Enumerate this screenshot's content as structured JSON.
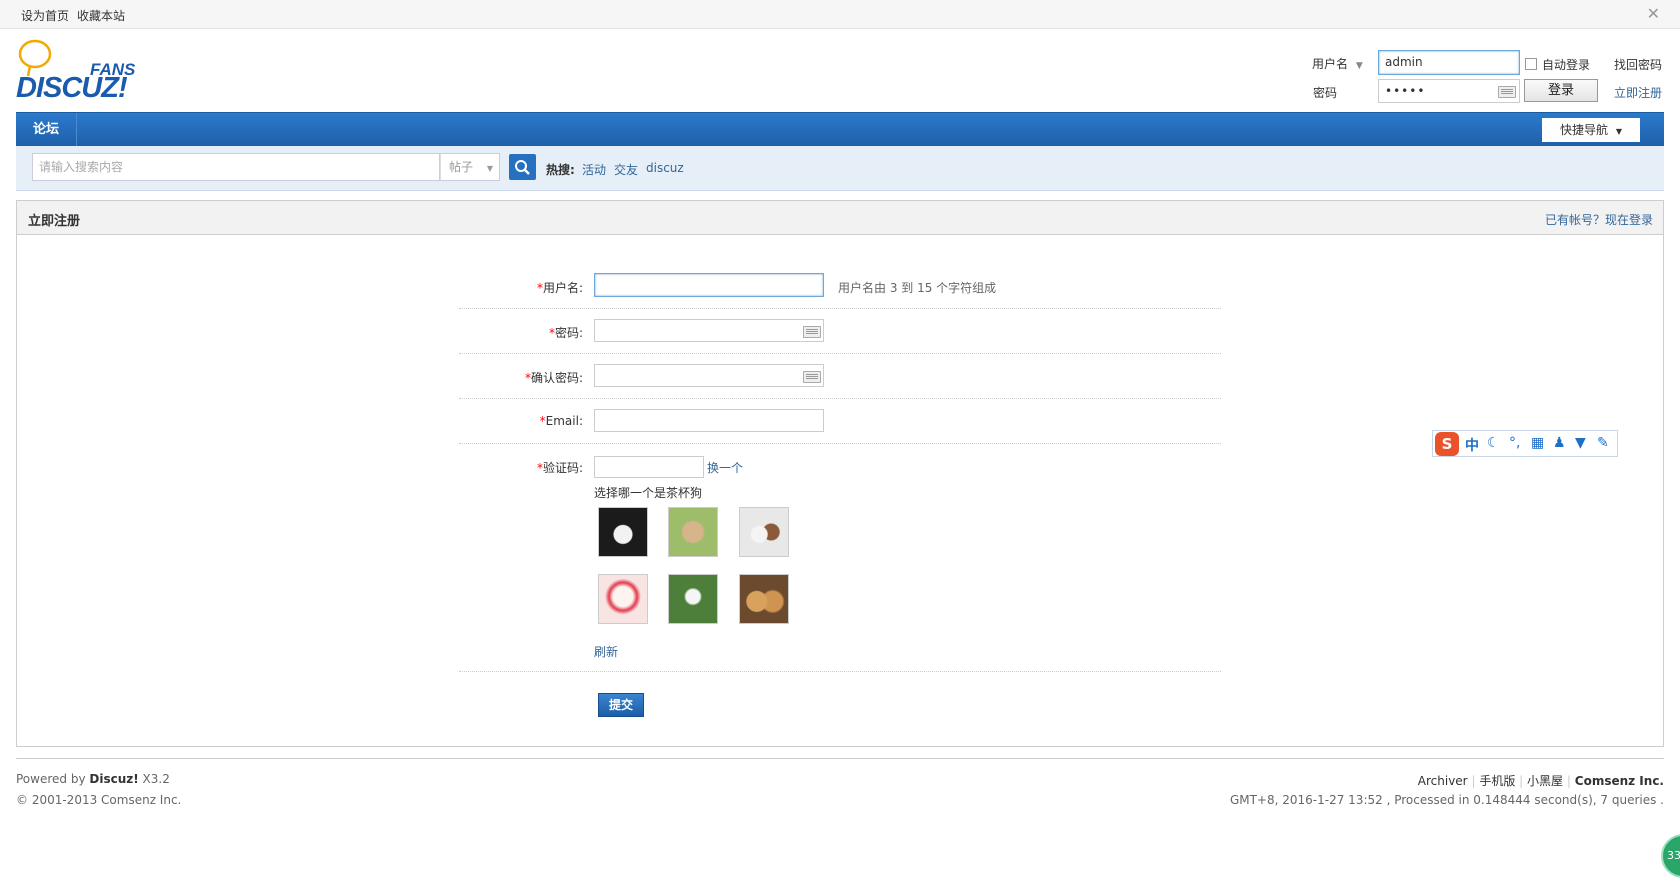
{
  "topbar": {
    "set_home": "设为首页",
    "bookmark": "收藏本站"
  },
  "logo": {
    "fans": "FANS",
    "discuz": "DISCUZ!"
  },
  "login": {
    "username_label": "用户名",
    "username_value": "admin",
    "auto_login": "自动登录",
    "find_password": "找回密码",
    "password_label": "密码",
    "password_value": "•••••",
    "login_button": "登录",
    "register": "立即注册"
  },
  "nav": {
    "forum": "论坛",
    "quick_nav": "快捷导航"
  },
  "search": {
    "placeholder": "请输入搜索内容",
    "scope": "帖子",
    "hot_label": "热搜:",
    "hot_terms": [
      "活动",
      "交友",
      "discuz"
    ]
  },
  "panel": {
    "title": "立即注册",
    "have_account": "已有帐号？现在登录"
  },
  "form": {
    "username_label": "用户名:",
    "username_hint": "用户名由 3 到 15 个字符组成",
    "password_label": "密码:",
    "confirm_label": "确认密码:",
    "email_label": "Email:",
    "captcha_label": "验证码:",
    "captcha_change": "换一个",
    "captcha_question": "选择哪一个是茶杯狗",
    "refresh": "刷新",
    "submit": "提交",
    "required_mark": "*"
  },
  "ime": {
    "char": "中"
  },
  "footer": {
    "powered_prefix": "Powered by ",
    "powered_brand": "Discuz!",
    "powered_version": " X3.2",
    "copyright": "© 2001-2013 Comsenz Inc.",
    "links": [
      "Archiver",
      "手机版",
      "小黑屋"
    ],
    "company": "Comsenz Inc.",
    "stats": "GMT+8, 2016-1-27 13:52 , Processed in 0.148444 second(s), 7 queries .",
    "badge": "33"
  },
  "colors": {
    "nav_blue": "#2570bf",
    "link": "#336699",
    "required": "#ff0000"
  }
}
